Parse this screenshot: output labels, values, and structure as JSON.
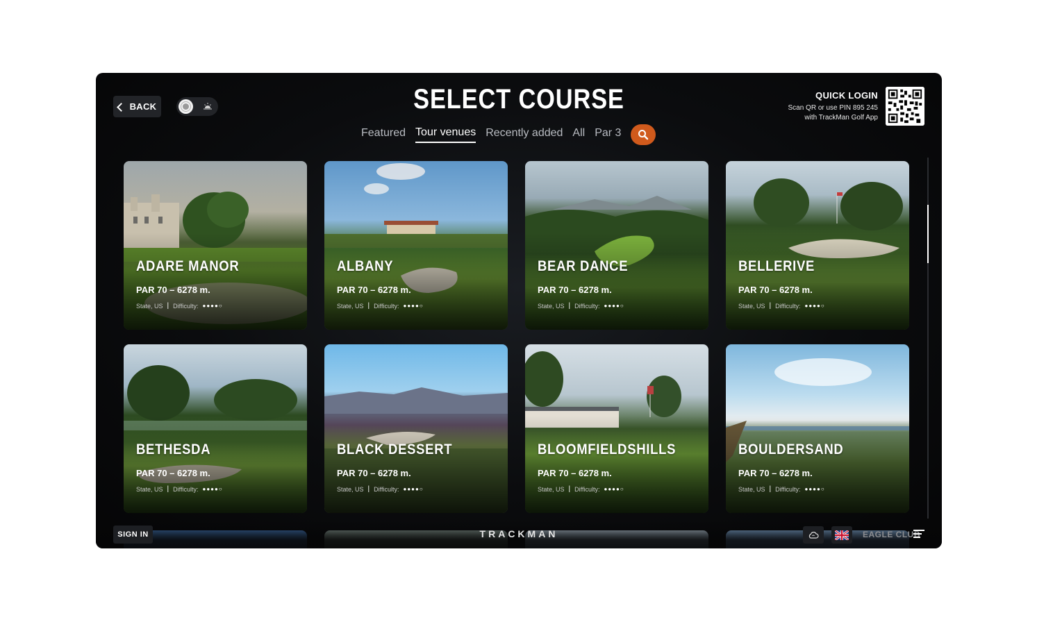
{
  "header": {
    "back_label": "BACK",
    "title": "SELECT COURSE",
    "tabs": [
      {
        "label": "Featured",
        "active": false
      },
      {
        "label": "Tour venues",
        "active": true
      },
      {
        "label": "Recently added",
        "active": false
      },
      {
        "label": "All",
        "active": false
      },
      {
        "label": "Par 3",
        "active": false
      }
    ],
    "search_icon": "search-icon",
    "theme_toggle": {
      "light_icon": "sun-icon",
      "dark_icon": "sunset-icon"
    }
  },
  "quick_login": {
    "title": "QUICK LOGIN",
    "line1": "Scan QR or use PIN 895 245",
    "line2": "with TrackMan Golf App"
  },
  "courses": [
    {
      "name": "ADARE MANOR",
      "par": "PAR 70  –  6278 m.",
      "location": "State, US",
      "sep": "|",
      "difficulty_label": "Difficulty:",
      "difficulty": "●●●●○",
      "difficulty_value": 4
    },
    {
      "name": "ALBANY",
      "par": "PAR 70  –  6278 m.",
      "location": "State, US",
      "sep": "|",
      "difficulty_label": "Difficulty:",
      "difficulty": "●●●●○",
      "difficulty_value": 4
    },
    {
      "name": "BEAR DANCE",
      "par": "PAR 70  –  6278 m.",
      "location": "State, US",
      "sep": "|",
      "difficulty_label": "Difficulty:",
      "difficulty": "●●●●○",
      "difficulty_value": 4
    },
    {
      "name": "BELLERIVE",
      "par": "PAR 70  –  6278 m.",
      "location": "State, US",
      "sep": "|",
      "difficulty_label": "Difficulty:",
      "difficulty": "●●●●○",
      "difficulty_value": 4
    },
    {
      "name": "BETHESDA",
      "par": "PAR 70  –  6278 m.",
      "location": "State, US",
      "sep": "|",
      "difficulty_label": "Difficulty:",
      "difficulty": "●●●●○",
      "difficulty_value": 4
    },
    {
      "name": "BLACK DESSERT",
      "par": "PAR 70  –  6278 m.",
      "location": "State, US",
      "sep": "|",
      "difficulty_label": "Difficulty:",
      "difficulty": "●●●●○",
      "difficulty_value": 4
    },
    {
      "name": "BLOOMFIELDSHILLS",
      "par": "PAR 70  –  6278 m.",
      "location": "State, US",
      "sep": "|",
      "difficulty_label": "Difficulty:",
      "difficulty": "●●●●○",
      "difficulty_value": 4
    },
    {
      "name": "BOULDERSAND",
      "par": "PAR 70  –  6278 m.",
      "location": "State, US",
      "sep": "|",
      "difficulty_label": "Difficulty:",
      "difficulty": "●●●●○",
      "difficulty_value": 4
    }
  ],
  "footer": {
    "sign_in": "SIGN IN",
    "brand": "TRACKMAN",
    "club": "EAGLE CLUB",
    "cloud_icon": "cloud-sync-icon",
    "flag_icon": "uk-flag-icon",
    "menu_icon": "menu-icon"
  },
  "colors": {
    "accent": "#d05a1c",
    "background": "#0b0c0e"
  }
}
